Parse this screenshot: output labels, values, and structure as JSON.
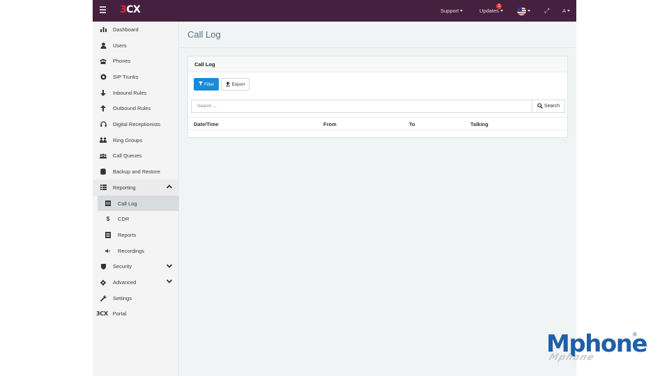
{
  "topbar": {
    "logo": "3CX",
    "nav": {
      "support": "Support",
      "updates": "Updates",
      "updates_badge": "1",
      "user_initial": "A"
    }
  },
  "sidebar": {
    "items": [
      {
        "label": "Dashboard",
        "icon": "bar-chart-icon"
      },
      {
        "label": "Users",
        "icon": "user-icon"
      },
      {
        "label": "Phones",
        "icon": "phone-icon"
      },
      {
        "label": "SIP Trunks",
        "icon": "globe-icon"
      },
      {
        "label": "Inbound Rules",
        "icon": "arrow-down-icon"
      },
      {
        "label": "Outbound Rules",
        "icon": "arrow-up-icon"
      },
      {
        "label": "Digital Receptionists",
        "icon": "headset-icon"
      },
      {
        "label": "Ring Groups",
        "icon": "group-icon"
      },
      {
        "label": "Call Queues",
        "icon": "queue-icon"
      },
      {
        "label": "Backup and Restore",
        "icon": "database-icon"
      },
      {
        "label": "Reporting",
        "icon": "list-icon",
        "expanded": true
      },
      {
        "label": "Call Log",
        "icon": "calendar-icon",
        "active": true
      },
      {
        "label": "CDR",
        "icon": "dollar-icon"
      },
      {
        "label": "Reports",
        "icon": "report-icon"
      },
      {
        "label": "Recordings",
        "icon": "speaker-icon"
      },
      {
        "label": "Security",
        "icon": "shield-icon"
      },
      {
        "label": "Advanced",
        "icon": "gear-icon"
      },
      {
        "label": "Settings",
        "icon": "wrench-icon"
      },
      {
        "label": "Portal",
        "icon": "3cx-logo-icon",
        "prefix": "3CX"
      }
    ]
  },
  "main": {
    "page_title": "Call Log",
    "panel": {
      "title": "Call Log",
      "filter_label": "Filter",
      "export_label": "Export",
      "search_placeholder": "Search ...",
      "search_button": "Search",
      "columns": [
        "Date/Time",
        "From",
        "To",
        "Talking"
      ]
    }
  },
  "brand": {
    "name": "Mphone",
    "mark": "®",
    "reflection": "Mphone"
  },
  "colors": {
    "topbar": "#45203f",
    "accent": "#1a8bd6",
    "brand": "#1f5fa9"
  }
}
